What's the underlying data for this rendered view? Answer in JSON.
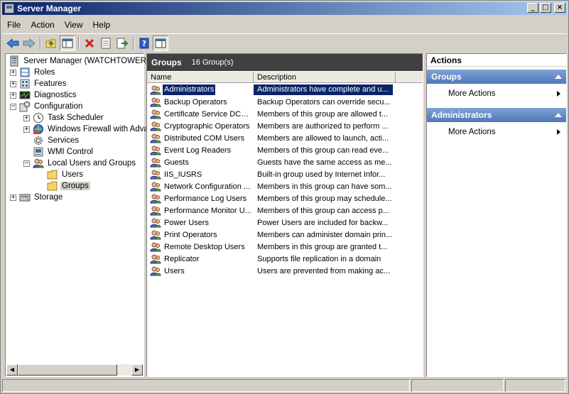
{
  "window": {
    "title": "Server Manager",
    "buttons": [
      "_",
      "□",
      "×"
    ]
  },
  "menu": [
    "File",
    "Action",
    "View",
    "Help"
  ],
  "toolbar": [
    "back-icon",
    "forward-icon",
    "up-folder-icon",
    "show-hide-tree-icon",
    "delete-icon",
    "properties-icon",
    "export-list-icon",
    "help-icon",
    "show-hide-action-pane-icon"
  ],
  "tree": {
    "root": "Server Manager (WATCHTOWER)",
    "items": [
      {
        "label": "Roles",
        "expander": "+"
      },
      {
        "label": "Features",
        "expander": "+"
      },
      {
        "label": "Diagnostics",
        "expander": "+"
      },
      {
        "label": "Configuration",
        "expander": "−"
      },
      {
        "label": "Task Scheduler",
        "expander": "+"
      },
      {
        "label": "Windows Firewall with Adva",
        "expander": "+"
      },
      {
        "label": "Services"
      },
      {
        "label": "WMI Control"
      },
      {
        "label": "Local Users and Groups",
        "expander": "−"
      },
      {
        "label": "Users"
      },
      {
        "label": "Groups"
      },
      {
        "label": "Storage",
        "expander": "+"
      }
    ]
  },
  "center": {
    "title": "Groups",
    "count": "16 Group(s)",
    "columns": {
      "name": "Name",
      "description": "Description"
    },
    "rows": [
      {
        "name": "Administrators",
        "description": "Administrators have complete and u..."
      },
      {
        "name": "Backup Operators",
        "description": "Backup Operators can override secu..."
      },
      {
        "name": "Certificate Service DCO...",
        "description": "Members of this group are allowed t..."
      },
      {
        "name": "Cryptographic Operators",
        "description": "Members are authorized to perform ..."
      },
      {
        "name": "Distributed COM Users",
        "description": "Members are allowed to launch, acti..."
      },
      {
        "name": "Event Log Readers",
        "description": "Members of this group can read eve..."
      },
      {
        "name": "Guests",
        "description": "Guests have the same access as me..."
      },
      {
        "name": "IIS_IUSRS",
        "description": "Built-in group used by Internet Infor..."
      },
      {
        "name": "Network Configuration ...",
        "description": "Members in this group can have som..."
      },
      {
        "name": "Performance Log Users",
        "description": "Members of this group may schedule..."
      },
      {
        "name": "Performance Monitor U...",
        "description": "Members of this group can access p..."
      },
      {
        "name": "Power Users",
        "description": "Power Users are included for backw..."
      },
      {
        "name": "Print Operators",
        "description": "Members can administer domain prin..."
      },
      {
        "name": "Remote Desktop Users",
        "description": "Members in this group are granted t..."
      },
      {
        "name": "Replicator",
        "description": "Supports file replication in a domain"
      },
      {
        "name": "Users",
        "description": "Users are prevented from making ac..."
      }
    ]
  },
  "actions": {
    "title": "Actions",
    "sections": [
      {
        "title": "Groups",
        "item": "More Actions"
      },
      {
        "title": "Administrators",
        "item": "More Actions"
      }
    ]
  }
}
